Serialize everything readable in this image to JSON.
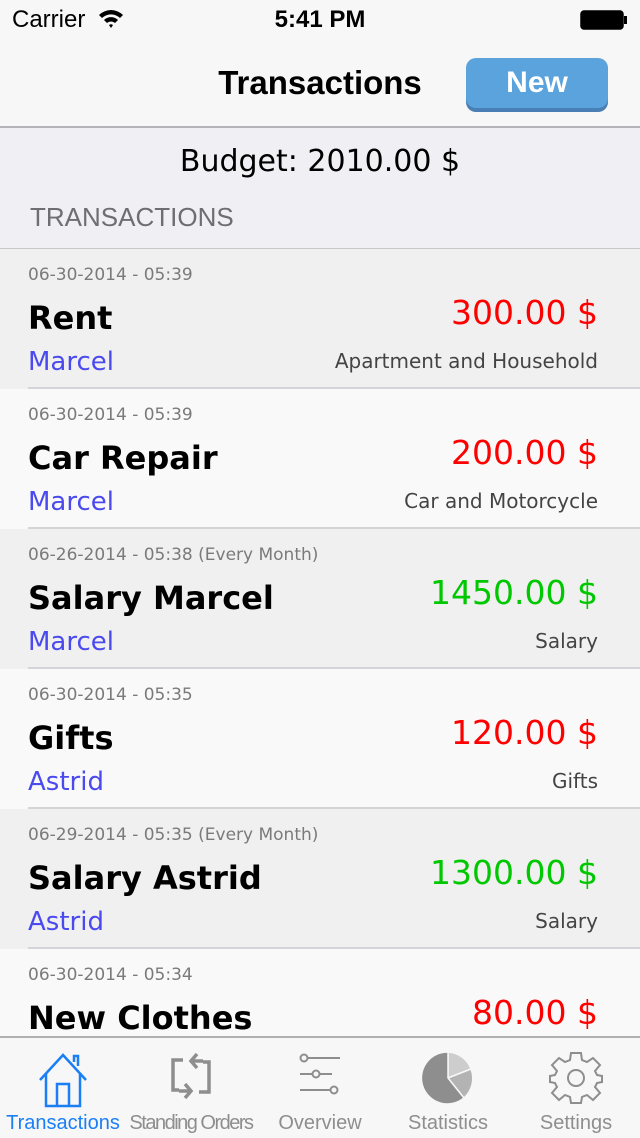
{
  "status_bar": {
    "carrier": "Carrier",
    "time": "5:41 PM"
  },
  "nav": {
    "title": "Transactions",
    "new_button": "New"
  },
  "budget": {
    "label": "Budget: 2010.00 $"
  },
  "section": {
    "header": "TRANSACTIONS"
  },
  "colors": {
    "expense": "#ff0000",
    "income": "#00c800",
    "person": "#4a4aee",
    "accent": "#1a7ff5"
  },
  "transactions": [
    {
      "date": "06-30-2014 - 05:39",
      "name": "Rent",
      "amount": "300.00 $",
      "type": "expense",
      "person": "Marcel",
      "category": "Apartment and Household"
    },
    {
      "date": "06-30-2014 - 05:39",
      "name": "Car Repair",
      "amount": "200.00 $",
      "type": "expense",
      "person": "Marcel",
      "category": "Car and Motorcycle"
    },
    {
      "date": "06-26-2014 - 05:38 (Every Month)",
      "name": "Salary Marcel",
      "amount": "1450.00 $",
      "type": "income",
      "person": "Marcel",
      "category": "Salary"
    },
    {
      "date": "06-30-2014 - 05:35",
      "name": "Gifts",
      "amount": "120.00 $",
      "type": "expense",
      "person": "Astrid",
      "category": "Gifts"
    },
    {
      "date": "06-29-2014 - 05:35 (Every Month)",
      "name": "Salary Astrid",
      "amount": "1300.00 $",
      "type": "income",
      "person": "Astrid",
      "category": "Salary"
    },
    {
      "date": "06-30-2014 - 05:34",
      "name": "New Clothes",
      "amount": "80.00 $",
      "type": "expense",
      "person": "",
      "category": ""
    }
  ],
  "tabs": [
    {
      "label": "Transactions",
      "icon": "home-icon",
      "active": true
    },
    {
      "label": "Standing Orders",
      "icon": "repeat-icon",
      "active": false
    },
    {
      "label": "Overview",
      "icon": "sliders-icon",
      "active": false
    },
    {
      "label": "Statistics",
      "icon": "pie-chart-icon",
      "active": false
    },
    {
      "label": "Settings",
      "icon": "gear-icon",
      "active": false
    }
  ]
}
